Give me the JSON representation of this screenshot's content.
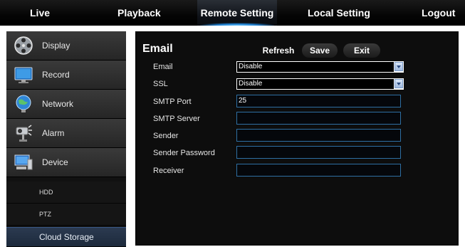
{
  "nav": {
    "tabs": [
      "Live",
      "Playback",
      "Remote Setting",
      "Local Setting",
      "Logout"
    ],
    "active": "Remote Setting"
  },
  "sidebar": {
    "items": [
      {
        "label": "Display",
        "icon": "film-reel-icon"
      },
      {
        "label": "Record",
        "icon": "monitor-icon"
      },
      {
        "label": "Network",
        "icon": "globe-icon"
      },
      {
        "label": "Alarm",
        "icon": "camera-alarm-icon"
      },
      {
        "label": "Device",
        "icon": "computer-icon"
      }
    ],
    "subitems": [
      "HDD",
      "PTZ",
      "Cloud Storage"
    ],
    "active_sub": "Cloud Storage"
  },
  "email": {
    "title": "Email",
    "buttons": {
      "refresh": "Refresh",
      "save": "Save",
      "exit": "Exit"
    },
    "fields": {
      "email": {
        "label": "Email",
        "value": "Disable"
      },
      "ssl": {
        "label": "SSL",
        "value": "Disable"
      },
      "smtp_port": {
        "label": "SMTP Port",
        "value": "25"
      },
      "smtp_server": {
        "label": "SMTP Server",
        "value": ""
      },
      "sender": {
        "label": "Sender",
        "value": ""
      },
      "sender_password": {
        "label": "Sender Password",
        "value": ""
      },
      "receiver": {
        "label": "Receiver",
        "value": ""
      }
    }
  },
  "colors": {
    "accent": "#2e6fa3",
    "panel": "#0d0d0d"
  }
}
